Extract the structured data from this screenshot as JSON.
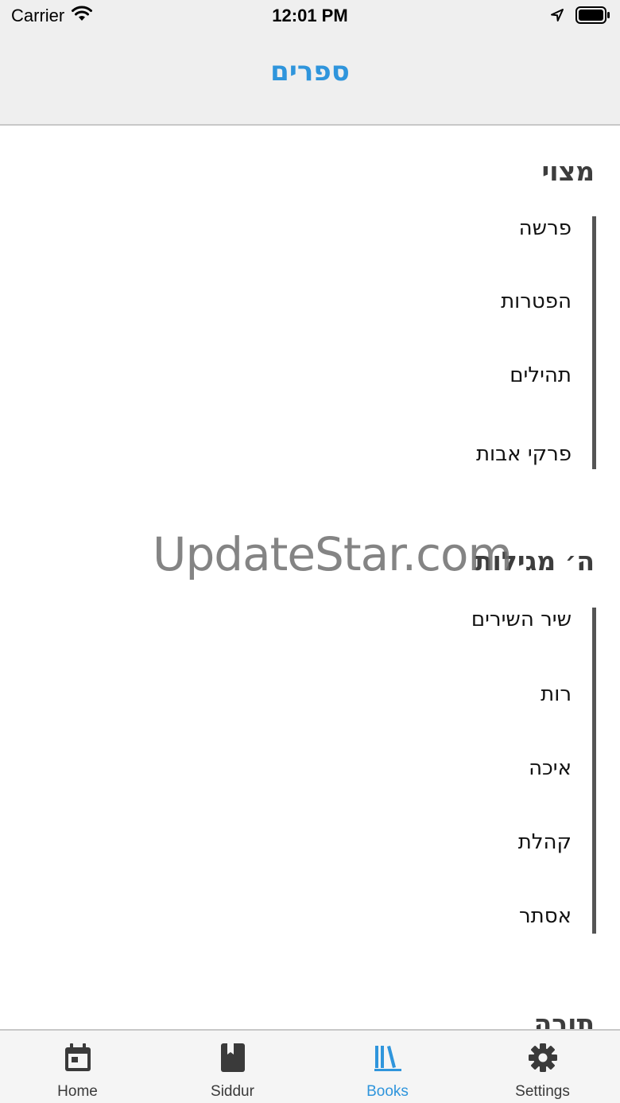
{
  "status_bar": {
    "carrier": "Carrier",
    "time": "12:01 PM"
  },
  "header": {
    "title": "ספרים"
  },
  "sections": [
    {
      "title": "מצוי",
      "items": [
        "פרשה",
        "הפטרות",
        "תהילים",
        "פרקי אבות"
      ]
    },
    {
      "title": "ה׳ מגילות",
      "items": [
        "שיר השירים",
        "רות",
        "איכה",
        "קהלת",
        "אסתר"
      ]
    },
    {
      "title": "תורה",
      "items": []
    }
  ],
  "watermark": "UpdateStar.com",
  "tabs": [
    {
      "label": "Home",
      "icon": "calendar-icon"
    },
    {
      "label": "Siddur",
      "icon": "book-icon"
    },
    {
      "label": "Books",
      "icon": "books-icon"
    },
    {
      "label": "Settings",
      "icon": "gear-icon"
    }
  ],
  "colors": {
    "accent": "#2f95dc",
    "icon": "#3a3a3a",
    "header_bg": "#efefef"
  }
}
